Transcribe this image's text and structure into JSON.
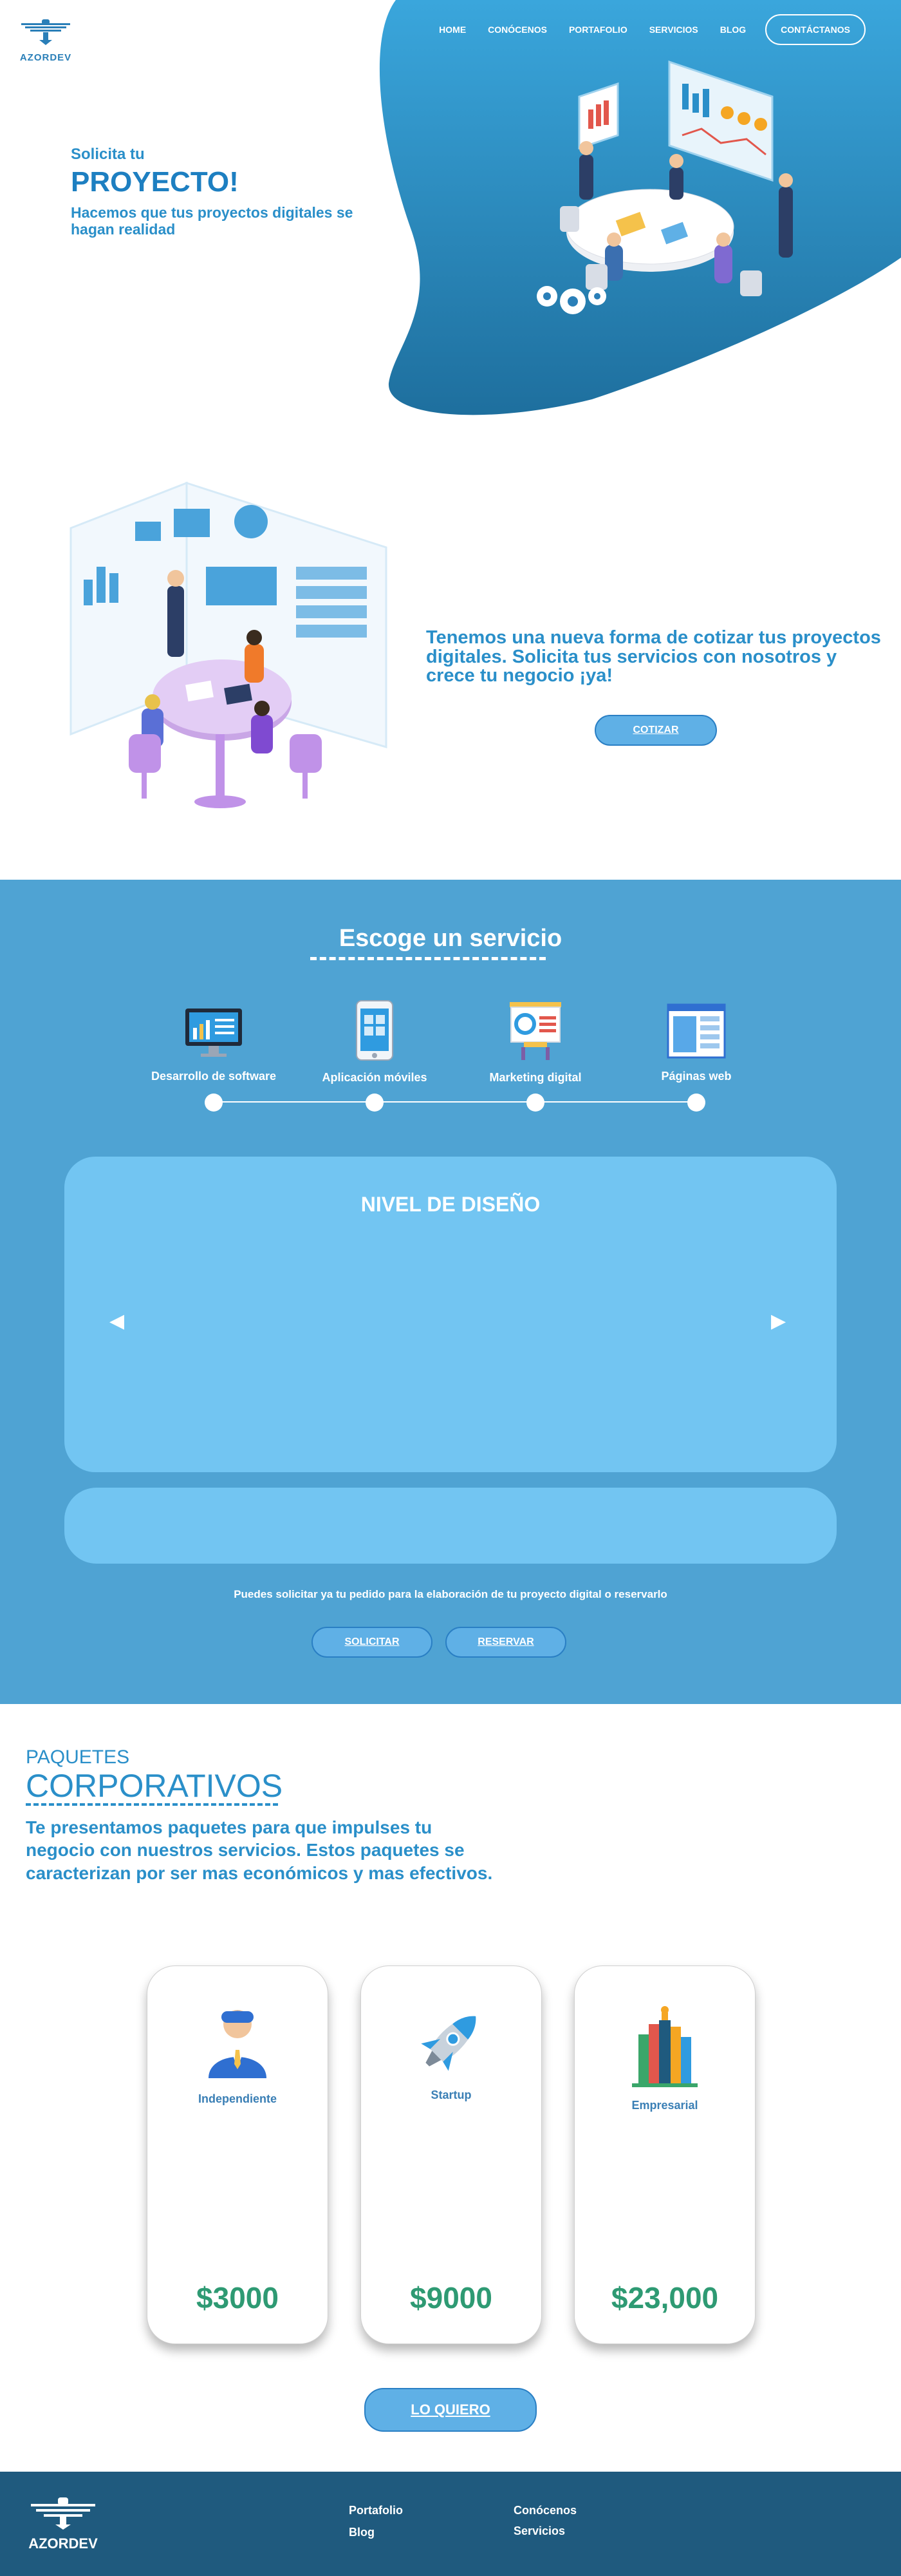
{
  "brand": {
    "name": "AZORDEV"
  },
  "nav": {
    "items": [
      "HOME",
      "CONÓCENOS",
      "PORTAFOLIO",
      "SERVICIOS",
      "BLOG"
    ],
    "contact_label": "CONTÁCTANOS"
  },
  "hero": {
    "kicker": "Solicita tu",
    "title": "PROYECTO!",
    "subtitle": "Hacemos que tus proyectos digitales se hagan realidad"
  },
  "quote": {
    "text": "Tenemos una nueva forma de cotizar tus proyectos digitales. Solicita tus servicios con nosotros y crece tu negocio ¡ya!",
    "button": "COTIZAR"
  },
  "services": {
    "title": "Escoge un servicio",
    "items": [
      {
        "label": "Desarrollo de software",
        "icon": "monitor-chart-icon"
      },
      {
        "label": "Aplicación móviles",
        "icon": "smartphone-icon"
      },
      {
        "label": "Marketing digital",
        "icon": "presentation-board-icon"
      },
      {
        "label": "Páginas web",
        "icon": "browser-window-icon"
      }
    ],
    "panel_title": "NIVEL DE DISEÑO",
    "prev": "◀",
    "next": "▶",
    "note": "Puedes solicitar ya tu pedido para la elaboración de tu proyecto digital o reservarlo",
    "solicitar": "SOLICITAR",
    "reservar": "RESERVAR"
  },
  "packages": {
    "kicker": "PAQUETES",
    "title": "CORPORATIVOS",
    "description": "Te presentamos paquetes para que impulses tu negocio con nuestros servicios. Estos paquetes se caracterizan por ser mas económicos y mas efectivos.",
    "cards": [
      {
        "name": "Independiente",
        "price": "$3000",
        "icon": "businessman-icon"
      },
      {
        "name": "Startup",
        "price": "$9000",
        "icon": "rocket-icon"
      },
      {
        "name": "Empresarial",
        "price": "$23,000",
        "icon": "buildings-icon"
      }
    ],
    "cta": "LO QUIERO"
  },
  "footer": {
    "brand": "AZORDEV",
    "links": [
      "Portafolio",
      "Blog",
      "Conócenos",
      "Servicios"
    ]
  },
  "colors": {
    "primary": "#2a8fc9",
    "services_bg": "#4fa3d3",
    "panel": "#72c5f2",
    "footer": "#1f5a7e",
    "price": "#2e9a73"
  }
}
